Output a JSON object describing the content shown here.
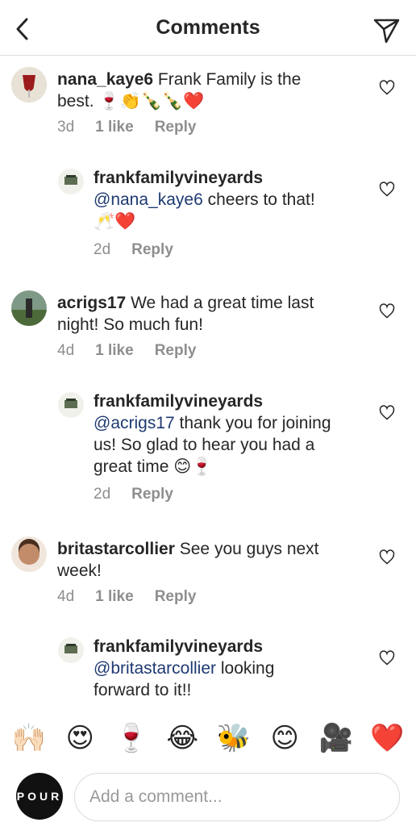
{
  "header": {
    "title": "Comments",
    "back_icon": "chevron-left-icon",
    "send_icon": "paper-plane-icon"
  },
  "comments": [
    {
      "username": "nana_kaye6",
      "text": " Frank Family is the",
      "text2": "best. 🍷👏🍾🍾❤️",
      "time": "3d",
      "likes": "1 like",
      "reply": "Reply",
      "replies": [
        {
          "username": "frankfamilyvineyards",
          "mention": "@nana_kaye6",
          "text": " cheers to that!",
          "text2": "🥂❤️",
          "time": "2d",
          "reply": "Reply"
        }
      ]
    },
    {
      "username": "acrigs17",
      "text": " We had a great time last",
      "text2": "night!  So much fun!",
      "time": "4d",
      "likes": "1 like",
      "reply": "Reply",
      "replies": [
        {
          "username": "frankfamilyvineyards",
          "mention": "@acrigs17",
          "text": " thank you for joining",
          "text2": "us! So glad to hear you had a",
          "text3": "great time 😊🍷",
          "time": "2d",
          "reply": "Reply"
        }
      ]
    },
    {
      "username": "britastarcollier",
      "text": " See you guys next",
      "text2": "week!",
      "time": "4d",
      "likes": "1 like",
      "reply": "Reply",
      "replies": [
        {
          "username": "frankfamilyvineyards",
          "mention": "@britastarcollier",
          "text": " looking",
          "text2": "forward to it!!"
        }
      ]
    }
  ],
  "emoji_bar": [
    "🙌🏻",
    "😍",
    "🍷",
    "😂",
    "🐝",
    "😊",
    "🎥",
    "❤️"
  ],
  "composer": {
    "avatar_text": "POUR",
    "placeholder": "Add a comment..."
  }
}
